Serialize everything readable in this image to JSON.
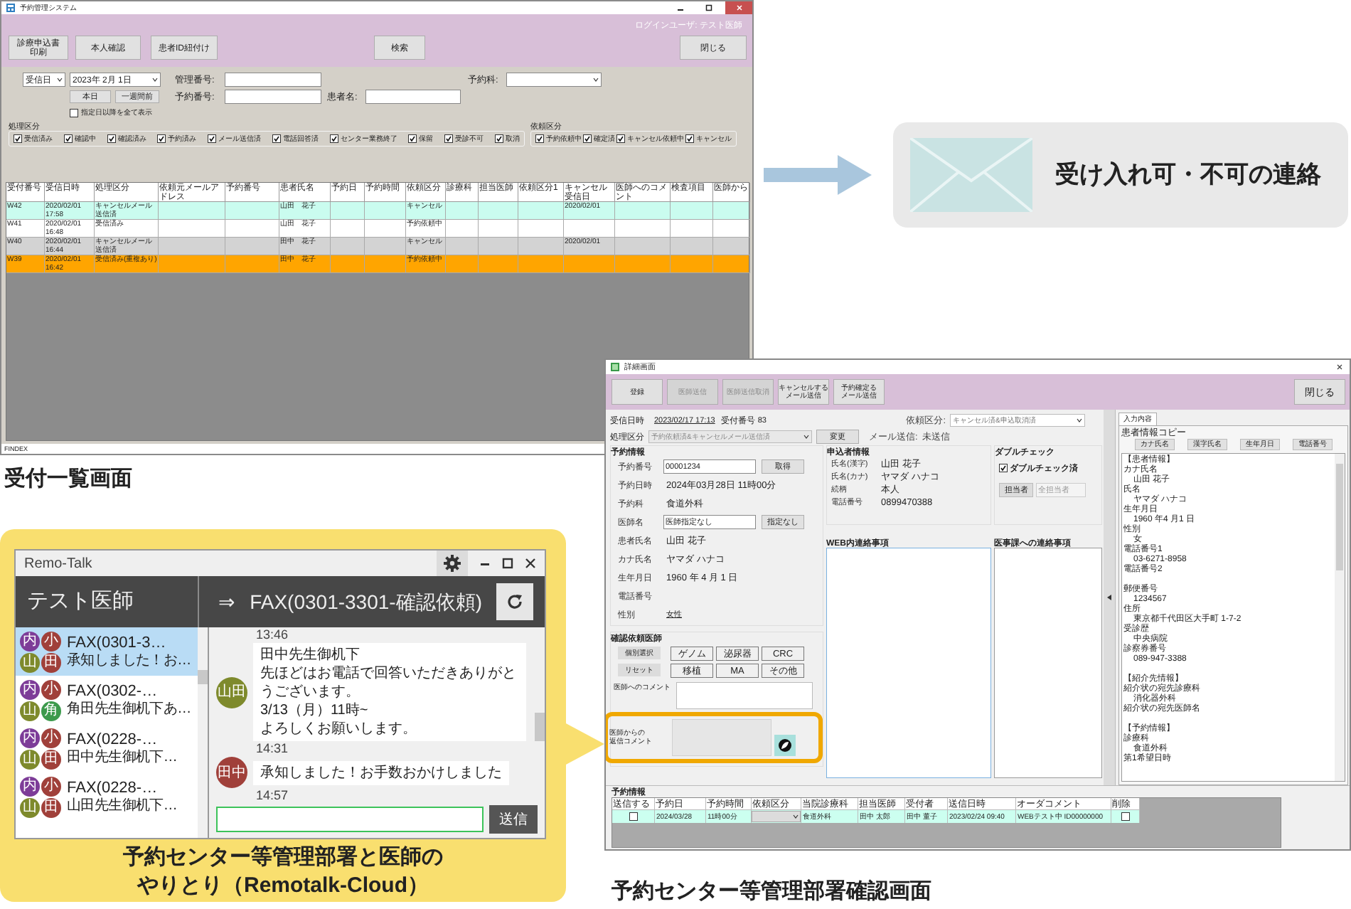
{
  "reception_screen": {
    "title": "予約管理システム",
    "login_user": "ログインユーザ: テスト医師",
    "buttons": [
      {
        "lines": [
          "診療申込書",
          "印刷"
        ]
      },
      {
        "lines": [
          "本人確認"
        ]
      },
      {
        "lines": [
          "患者ID紐付け"
        ]
      },
      {
        "lines": [
          "検索"
        ]
      },
      {
        "lines": [
          "閉じる"
        ]
      }
    ],
    "date_type": "受信日",
    "date": "2023年 2月 1日",
    "date_buttons": [
      "本日",
      "一週間前"
    ],
    "show_all": {
      "label": "指定日以降を全て表示",
      "checked": false
    },
    "management_no": {
      "label": "管理番号:"
    },
    "reservation_no": {
      "label": "予約番号:"
    },
    "patient_name": {
      "label": "患者名:"
    },
    "department": {
      "label": "予約科:"
    },
    "status_group": {
      "title": "処理区分",
      "items": [
        {
          "label": "受信済み",
          "checked": true
        },
        {
          "label": "確認中",
          "checked": true
        },
        {
          "label": "確認済み",
          "checked": true
        },
        {
          "label": "予約済み",
          "checked": true
        },
        {
          "label": "メール送信済",
          "checked": true
        },
        {
          "label": "電話回答済",
          "checked": true
        },
        {
          "label": "センター業務終了",
          "checked": true
        },
        {
          "label": "保留",
          "checked": true
        },
        {
          "label": "受診不可",
          "checked": true
        },
        {
          "label": "取消",
          "checked": true
        }
      ]
    },
    "request_group": {
      "title": "依頼区分",
      "items": [
        {
          "label": "予約依頼中",
          "checked": true
        },
        {
          "label": "確定済",
          "checked": true
        },
        {
          "label": "キャンセル依頼中",
          "checked": true
        },
        {
          "label": "キャンセル",
          "checked": true
        }
      ]
    },
    "table": {
      "columns": [
        "受付番号",
        "受信日時",
        "処理区分",
        "依頼元メールアドレス",
        "予約番号",
        "患者氏名",
        "予約日",
        "予約時間",
        "依頼区分",
        "診療科",
        "担当医師",
        "依頼区分1",
        "キャンセル受信日",
        "医師へのコメント",
        "検査項目",
        "医師から"
      ],
      "rows": [
        {
          "color": "#cafcef",
          "cells": [
            "W42",
            "2020/02/01 17:58",
            "キャンセルメール送信済",
            null,
            null,
            "山田　花子",
            null,
            null,
            "キャンセル",
            null,
            null,
            null,
            "2020/02/01",
            null,
            null,
            null
          ]
        },
        {
          "color": "#ffffff",
          "cells": [
            "W41",
            "2020/02/01 16:48",
            "受信済み",
            null,
            null,
            "山田　花子",
            null,
            null,
            "予約依頼中",
            null,
            null,
            null,
            null,
            null,
            null,
            null
          ]
        },
        {
          "color": "#d3d3d3",
          "cells": [
            "W40",
            "2020/02/01 16:44",
            "キャンセルメール送信済",
            null,
            null,
            "田中　花子",
            null,
            null,
            "キャンセル",
            null,
            null,
            null,
            "2020/02/01",
            null,
            null,
            null
          ]
        },
        {
          "color": "#ffa500",
          "cells": [
            "W39",
            "2020/02/01 16:42",
            "受信済み(重複あり)",
            null,
            null,
            "田中　花子",
            null,
            null,
            "予約依頼中",
            null,
            null,
            null,
            null,
            null,
            null,
            null
          ]
        }
      ]
    },
    "status_bar": "FINDEX",
    "caption": "受付一覧画面"
  },
  "notice": {
    "text": "受け入れ可・不可の連絡"
  },
  "chat": {
    "title": "Remo-Talk",
    "user": "テスト医師",
    "arrow": "⇒",
    "thread_title": "FAX(0301-3301-確認依頼)",
    "threads": [
      {
        "title": "FAX(0301-3…",
        "preview": "承知しました！お…",
        "selected": true,
        "badges": [
          {
            "text": "内",
            "color": "#7d3c98"
          },
          {
            "text": "小",
            "color": "#a0403a"
          },
          {
            "text": "山",
            "color": "#7e8a2c"
          },
          {
            "text": "田",
            "color": "#a0403a"
          }
        ]
      },
      {
        "title": "FAX(0302-…",
        "preview": "角田先生御机下あ…",
        "selected": false,
        "badges": [
          {
            "text": "内",
            "color": "#7d3c98"
          },
          {
            "text": "小",
            "color": "#a0403a"
          },
          {
            "text": "山",
            "color": "#7e8a2c"
          },
          {
            "text": "角",
            "color": "#3c9a4c"
          }
        ]
      },
      {
        "title": "FAX(0228-…",
        "preview": "田中先生御机下…",
        "selected": false,
        "badges": [
          {
            "text": "内",
            "color": "#7d3c98"
          },
          {
            "text": "小",
            "color": "#a0403a"
          },
          {
            "text": "山",
            "color": "#7e8a2c"
          },
          {
            "text": "田",
            "color": "#a0403a"
          }
        ]
      },
      {
        "title": "FAX(0228-…",
        "preview": "山田先生御机下…",
        "selected": false,
        "badges": [
          {
            "text": "内",
            "color": "#7d3c98"
          },
          {
            "text": "小",
            "color": "#a0403a"
          },
          {
            "text": "山",
            "color": "#7e8a2c"
          },
          {
            "text": "田",
            "color": "#a0403a"
          }
        ]
      }
    ],
    "messages": [
      {
        "kind": "time",
        "text": "13:46"
      },
      {
        "kind": "message",
        "sender": "山田",
        "color": "#7e8a2c",
        "lines": [
          "田中先生御机下",
          "先ほどはお電話で回答いただきありがとうございます。",
          "3/13（月）11時~",
          "よろしくお願いします。"
        ]
      },
      {
        "kind": "time",
        "text": "14:31"
      },
      {
        "kind": "message",
        "sender": "田中",
        "color": "#a0403a",
        "lines": [
          "承知しました！お手数おかけしました"
        ]
      },
      {
        "kind": "time",
        "text": "14:57"
      }
    ],
    "send_button": "送信",
    "caption_lines": [
      "予約センター等管理部署と医師の",
      "やりとり（Remotalk-Cloud）"
    ]
  },
  "detail_screen": {
    "title": "詳細画面",
    "toolbar": [
      {
        "lines": [
          "登録"
        ],
        "disabled": false
      },
      {
        "lines": [
          "医師送信"
        ],
        "disabled": true
      },
      {
        "lines": [
          "医師送信取消"
        ],
        "disabled": true
      },
      {
        "lines": [
          "キャンセルする",
          "メール送信"
        ],
        "disabled": false
      },
      {
        "lines": [
          "予約確定る",
          "メール送信"
        ],
        "disabled": false
      }
    ],
    "close_button": "閉じる",
    "received": {
      "label": "受信日時",
      "value": "2023/02/17 17:13"
    },
    "reception_no": {
      "label": "受付番号",
      "value": "83"
    },
    "status": {
      "label": "処理区分",
      "value": "予約依頼済&キャンセルメール送信済",
      "button": "変更"
    },
    "request": {
      "label": "依頼区分:",
      "value": "キャンセル済&申込取消済"
    },
    "mail": {
      "label": "メール送信:",
      "value": "未送信"
    },
    "reservation": {
      "title": "予約情報",
      "rows": [
        {
          "label": "予約番号",
          "value": "00001234",
          "kind": "input",
          "button": "取得"
        },
        {
          "label": "予約日時",
          "value": "2024年03月28日 11時00分",
          "kind": "text"
        },
        {
          "label": "予約科",
          "value": "食道外科",
          "kind": "text"
        },
        {
          "label": "医師名",
          "value": "医師指定なし",
          "kind": "input",
          "button": "指定なし"
        },
        {
          "label": "患者氏名",
          "value": "山田 花子",
          "kind": "text"
        },
        {
          "label": "カナ氏名",
          "value": "ヤマダ ハナコ",
          "kind": "text"
        },
        {
          "label": "生年月日",
          "value": "1960 年 4 月 1 日",
          "kind": "text"
        },
        {
          "label": "電話番号",
          "kind": "text"
        },
        {
          "label": "性別",
          "value": "女性",
          "kind": "link"
        }
      ]
    },
    "applicant": {
      "title": "申込者情報",
      "rows": [
        {
          "label": "氏名(漢字)",
          "value": "山田 花子"
        },
        {
          "label": "氏名(カナ)",
          "value": "ヤマダ ハナコ"
        },
        {
          "label": "続柄",
          "value": "本人"
        },
        {
          "label": "電話番号",
          "value": "0899470388"
        }
      ]
    },
    "double_check": {
      "title": "ダブルチェック",
      "label": "ダブルチェック済",
      "checked": true,
      "button": "担当者",
      "placeholder": "全担当者"
    },
    "web_notes": {
      "title": "WEB内連絡事項"
    },
    "office_notes": {
      "title": "医事課への連絡事項"
    },
    "doctors": {
      "title": "確認依頼医師",
      "side_buttons": [
        "個別選択",
        "リセット"
      ],
      "buttons": [
        "ゲノム",
        "泌尿器",
        "CRC",
        "移植",
        "MA",
        "その他"
      ]
    },
    "comment": {
      "label": "医師へのコメント"
    },
    "reply": {
      "lines": [
        "医師からの",
        "返信コメント"
      ]
    },
    "bottom": {
      "title": "予約情報",
      "columns": [
        "送信する",
        "予約日",
        "予約時間",
        "依頼区分",
        "当院診療科",
        "担当医師",
        "受付者",
        "送信日時",
        "オーダコメント",
        "削除"
      ],
      "rows": [
        {
          "cells": [
            {
              "checked": false
            },
            "2024/03/28",
            "11時00分",
            null,
            "食道外科",
            "田中 太郎",
            "田中 董子",
            "2023/02/24 09:40",
            "WEBテスト中 ID00000000",
            {
              "checked": false
            }
          ]
        }
      ]
    },
    "side_panel": {
      "tab": "入力内容",
      "copy_label": "患者情報コピー",
      "buttons": [
        "カナ氏名",
        "漢字氏名",
        "生年月日",
        "電話番号"
      ],
      "sections": [
        {
          "lines": [
            {
              "text": "【患者情報】",
              "kind": "label"
            },
            {
              "text": "カナ氏名",
              "kind": "label"
            },
            {
              "text": "山田 花子",
              "kind": "value"
            },
            {
              "text": "氏名",
              "kind": "label"
            },
            {
              "text": "ヤマダ ハナコ",
              "kind": "value"
            },
            {
              "text": "生年月日",
              "kind": "label"
            },
            {
              "text": "1960 年4 月1 日",
              "kind": "value"
            },
            {
              "text": "性別",
              "kind": "label"
            },
            {
              "text": "女",
              "kind": "value"
            },
            {
              "text": "電話番号1",
              "kind": "label"
            },
            {
              "text": "03-6271-8958",
              "kind": "value"
            },
            {
              "text": "電話番号2",
              "kind": "label"
            }
          ]
        },
        {
          "lines": [
            {
              "text": "郵便番号",
              "kind": "label"
            },
            {
              "text": "1234567",
              "kind": "value"
            },
            {
              "text": "住所",
              "kind": "label"
            },
            {
              "text": "東京都千代田区大手町 1-7-2",
              "kind": "value"
            },
            {
              "text": "受診歴",
              "kind": "label"
            },
            {
              "text": "中央病院",
              "kind": "value"
            },
            {
              "text": "診察券番号",
              "kind": "label"
            },
            {
              "text": "089-947-3388",
              "kind": "value"
            }
          ]
        },
        {
          "lines": [
            {
              "text": "【紹介先情報】",
              "kind": "label"
            },
            {
              "text": "紹介状の宛先診療科",
              "kind": "label"
            },
            {
              "text": "消化器外科",
              "kind": "value"
            },
            {
              "text": "紹介状の宛先医師名",
              "kind": "label"
            }
          ]
        },
        {
          "lines": [
            {
              "text": "【予約情報】",
              "kind": "label"
            },
            {
              "text": "診療科",
              "kind": "label"
            },
            {
              "text": "食道外科",
              "kind": "value"
            },
            {
              "text": "第1希望日時",
              "kind": "label"
            }
          ]
        }
      ]
    },
    "caption": "予約センター等管理部署確認画面"
  }
}
